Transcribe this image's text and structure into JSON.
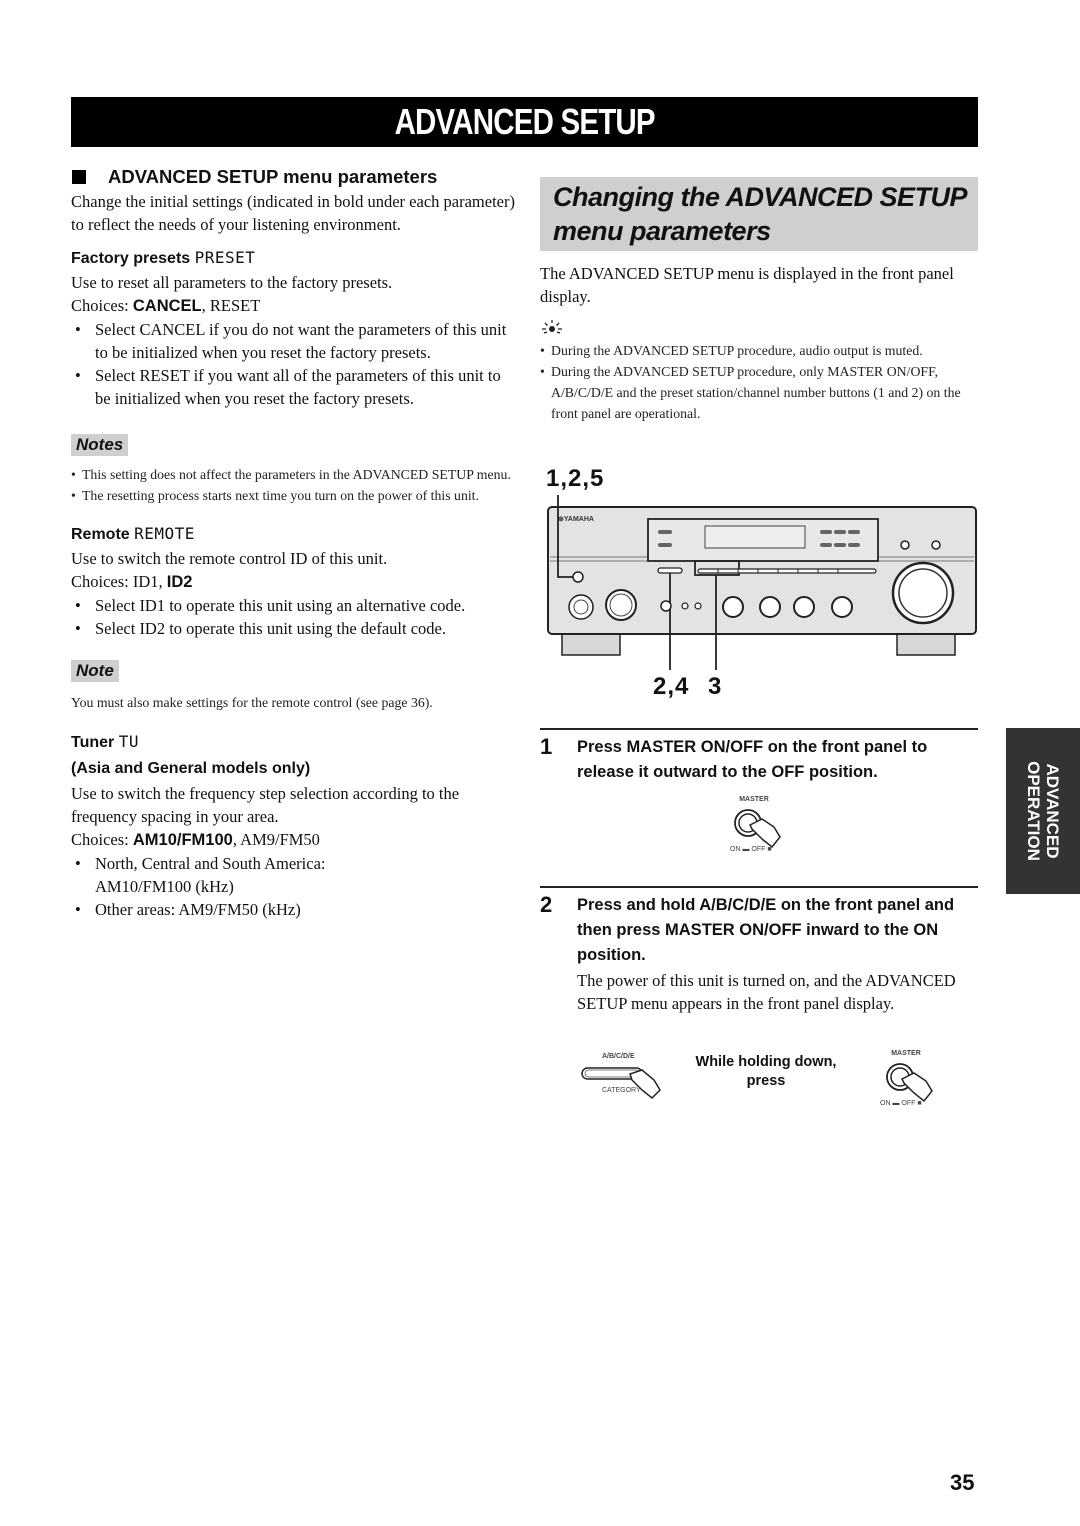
{
  "page_title": "ADVANCED SETUP",
  "left": {
    "section_heading": "ADVANCED SETUP menu parameters",
    "intro": "Change the initial settings (indicated in bold under each parameter) to reflect the needs of your listening environment.",
    "factory": {
      "heading": "Factory presets",
      "display_code": "PRESET",
      "desc": "Use to reset all parameters to the factory presets.",
      "choices_label": "Choices:",
      "choice_default": "CANCEL",
      "choice_other": ", RESET",
      "bullets": [
        "Select CANCEL if you do not want the parameters of this unit to be initialized when you reset the factory presets.",
        "Select RESET if you want all of the parameters of this unit to be initialized when you reset the factory presets."
      ]
    },
    "notes": {
      "tag": "Notes",
      "items": [
        "This setting does not affect the parameters in the ADVANCED SETUP menu.",
        "The resetting process starts next time you turn on the power of this unit."
      ]
    },
    "remote": {
      "heading": "Remote",
      "display_code": "REMOTE",
      "desc": "Use to switch the remote control ID of this unit.",
      "choices_label": "Choices:",
      "choice_other": "ID1, ",
      "choice_default": "ID2",
      "bullets": [
        "Select ID1 to operate this unit using an alternative code.",
        "Select ID2 to operate this unit using the default code."
      ]
    },
    "note": {
      "tag": "Note",
      "text": "You must also make settings for the remote control (see page 36)."
    },
    "tuner": {
      "heading": "Tuner",
      "display_code": "TU",
      "subheading": "(Asia and General models only)",
      "desc": "Use to switch the frequency step selection according to the frequency spacing in your area.",
      "choices_label": "Choices:",
      "choice_default": "AM10/FM100",
      "choice_other": ", AM9/FM50",
      "bullets": [
        "North, Central and South America: AM10/FM100 (kHz)",
        "Other areas: AM9/FM50 (kHz)"
      ]
    }
  },
  "right": {
    "heading": "Changing the ADVANCED SETUP menu parameters",
    "intro": "The ADVANCED SETUP menu is displayed in the front panel display.",
    "tip_icon": "lightbulb-tip-icon",
    "tips": [
      "During the ADVANCED SETUP procedure, audio output is muted.",
      "During the ADVANCED SETUP procedure, only MASTER ON/OFF, A/B/C/D/E and the preset station/channel number buttons (1 and 2) on the front panel are operational."
    ],
    "diagram": {
      "callout_top": "1,2,5",
      "callout_bottom_a": "2,4",
      "callout_bottom_b": "3",
      "brand": "YAMAHA"
    },
    "steps": [
      {
        "num": "1",
        "text": "Press MASTER ON/OFF on the front panel to release it outward to the OFF position.",
        "figure": {
          "master_label": "MASTER",
          "on_label": "ON",
          "off_label": "OFF"
        }
      },
      {
        "num": "2",
        "text": "Press and hold A/B/C/D/E on the front panel and then press MASTER ON/OFF inward to the ON position.",
        "body": "The power of this unit is turned on, and the ADVANCED SETUP menu appears in the front panel display.",
        "figure": {
          "abcde_label": "A/B/C/D/E",
          "category_label": "CATEGORY",
          "hold_text_1": "While holding down,",
          "hold_text_2": "press",
          "master_label": "MASTER",
          "on_label": "ON",
          "off_label": "OFF"
        }
      }
    ]
  },
  "side_tab": {
    "line1": "ADVANCED",
    "line2": "OPERATION"
  },
  "page_number": "35"
}
